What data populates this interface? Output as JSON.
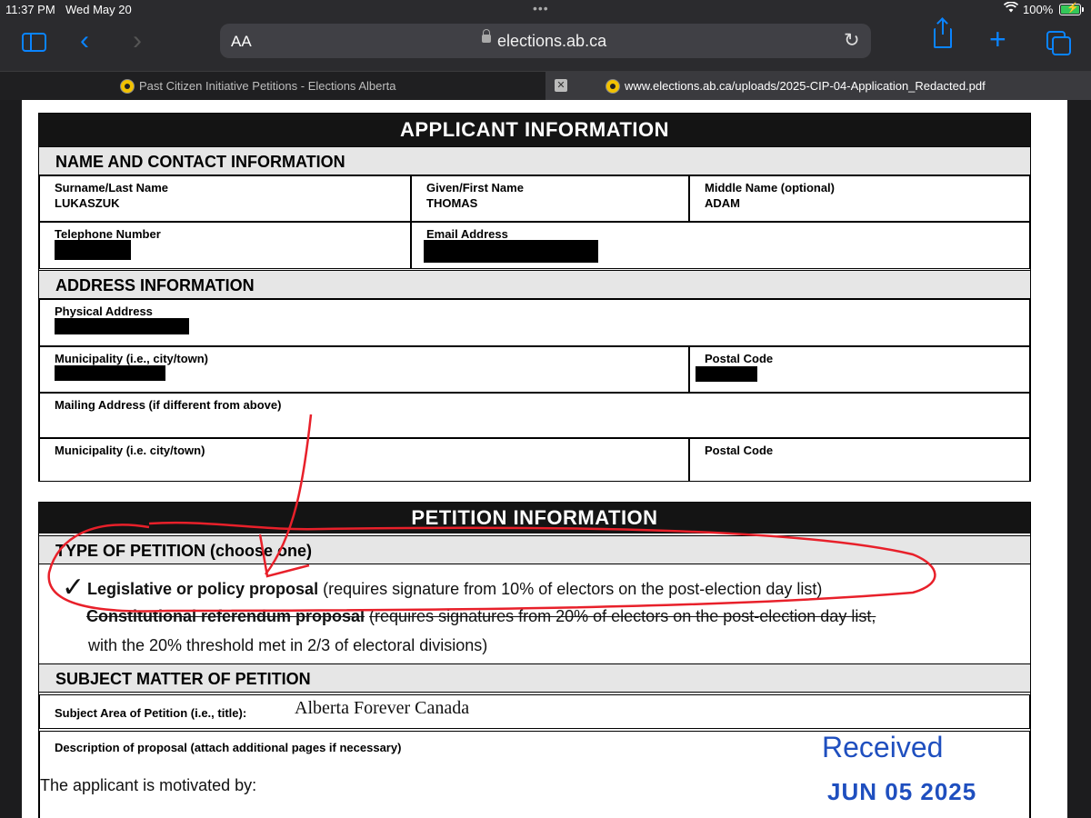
{
  "status_bar": {
    "time": "11:37 PM",
    "date": "Wed May 20",
    "battery": "100%",
    "battery_level": 1.0
  },
  "toolbar": {
    "text_size_label": "AA",
    "url": "elections.ab.ca"
  },
  "tabs": [
    {
      "title": "Past Citizen Initiative Petitions - Elections Alberta",
      "active": false
    },
    {
      "title": "www.elections.ab.ca/uploads/2025-CIP-04-Application_Redacted.pdf",
      "active": true
    }
  ],
  "document": {
    "applicant_header": "APPLICANT INFORMATION",
    "name_contact_header": "NAME AND CONTACT INFORMATION",
    "surname_label": "Surname/Last Name",
    "surname_value": "LUKASZUK",
    "given_label": "Given/First Name",
    "given_value": "THOMAS",
    "middle_label": "Middle Name (optional)",
    "middle_value": "ADAM",
    "phone_label": "Telephone Number",
    "email_label": "Email Address",
    "address_header": "ADDRESS INFORMATION",
    "physical_label": "Physical Address",
    "municipality_label": "Municipality (i.e., city/town)",
    "postal_label": "Postal Code",
    "mailing_label": "Mailing Address (if different from above)",
    "municipality2_label": "Municipality (i.e. city/town)",
    "postal2_label": "Postal Code",
    "petition_header": "PETITION INFORMATION",
    "type_header": "TYPE OF PETITION (choose one)",
    "option1_bold": "Legislative or policy proposal",
    "option1_rest": "(requires signature from 10% of electors on the post-election day list)",
    "option2_bold": "Constitutional referendum proposal",
    "option2_rest": "(requires signatures from 20% of electors on the post-election day list,",
    "option2_line2": "with the 20% threshold met in 2/3 of electoral divisions)",
    "subject_header": "SUBJECT MATTER OF PETITION",
    "subject_label": "Subject Area of Petition (i.e., title):",
    "subject_value": "Alberta Forever Canada",
    "description_label": "Description of proposal (attach additional pages if necessary)",
    "motivated_text": "The applicant is motivated by:",
    "stamp_received": "Received",
    "stamp_date": "JUN 05 2025",
    "checkmark": "✓"
  },
  "colors": {
    "annotation": "#e8202a",
    "stamp": "#1f4fbf",
    "accent": "#0a84ff"
  }
}
